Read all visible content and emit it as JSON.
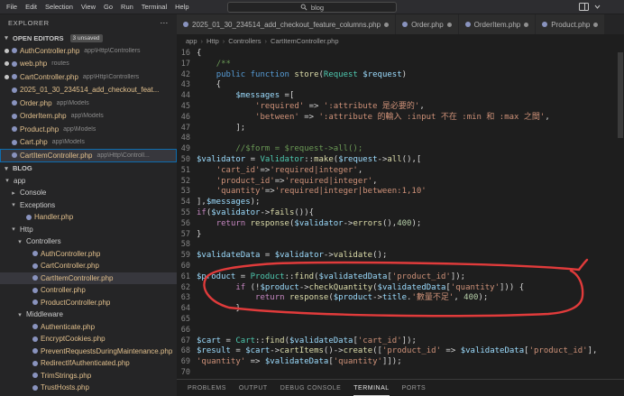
{
  "colors": {
    "titlebar_bg": "#2d2d30",
    "sidebar_bg": "#252526",
    "editor_bg": "#1e1e1e",
    "accent": "#007fd4",
    "git_modified": "#e2c08d",
    "annotation": "#e13b3b"
  },
  "titlebar": {
    "menus": [
      "File",
      "Edit",
      "Selection",
      "View",
      "Go",
      "Run",
      "Terminal",
      "Help"
    ],
    "search": {
      "value": "blog"
    }
  },
  "sidebar": {
    "title": "EXPLORER",
    "open_editors": {
      "label": "OPEN EDITORS",
      "badge": "3 unsaved",
      "items": [
        {
          "name": "AuthController.php",
          "path": "app\\Http\\Controllers",
          "dirty": true,
          "selected": false
        },
        {
          "name": "web.php",
          "path": "routes",
          "dirty": true,
          "selected": false
        },
        {
          "name": "CartController.php",
          "path": "app\\Http\\Controllers",
          "dirty": true,
          "selected": false
        },
        {
          "name": "2025_01_30_234514_add_checkout_feat...",
          "path": "",
          "dirty": false,
          "selected": false
        },
        {
          "name": "Order.php",
          "path": "app\\Models",
          "dirty": false,
          "selected": false
        },
        {
          "name": "OrderItem.php",
          "path": "app\\Models",
          "dirty": false,
          "selected": false
        },
        {
          "name": "Product.php",
          "path": "app\\Models",
          "dirty": false,
          "selected": false
        },
        {
          "name": "Cart.php",
          "path": "app\\Models",
          "dirty": false,
          "selected": false
        },
        {
          "name": "CartItemController.php",
          "path": "app\\Http\\Controll...",
          "dirty": false,
          "selected": true
        }
      ]
    },
    "workspace": {
      "label": "BLOG",
      "items": [
        {
          "label": "app",
          "indent": 0,
          "kind": "folder",
          "expanded": true,
          "selected": false
        },
        {
          "label": "Console",
          "indent": 1,
          "kind": "folder",
          "expanded": false,
          "selected": false
        },
        {
          "label": "Exceptions",
          "indent": 1,
          "kind": "folder",
          "expanded": true,
          "selected": false
        },
        {
          "label": "Handler.php",
          "indent": 2,
          "kind": "file",
          "selected": false
        },
        {
          "label": "Http",
          "indent": 1,
          "kind": "folder",
          "expanded": true,
          "selected": false
        },
        {
          "label": "Controllers",
          "indent": 2,
          "kind": "folder",
          "expanded": true,
          "selected": false
        },
        {
          "label": "AuthController.php",
          "indent": 3,
          "kind": "file",
          "selected": false
        },
        {
          "label": "CartController.php",
          "indent": 3,
          "kind": "file",
          "selected": false
        },
        {
          "label": "CartItemController.php",
          "indent": 3,
          "kind": "file",
          "selected": true
        },
        {
          "label": "Controller.php",
          "indent": 3,
          "kind": "file",
          "selected": false
        },
        {
          "label": "ProductController.php",
          "indent": 3,
          "kind": "file",
          "selected": false
        },
        {
          "label": "Middleware",
          "indent": 2,
          "kind": "folder",
          "expanded": true,
          "selected": false
        },
        {
          "label": "Authenticate.php",
          "indent": 3,
          "kind": "file",
          "selected": false
        },
        {
          "label": "EncryptCookies.php",
          "indent": 3,
          "kind": "file",
          "selected": false
        },
        {
          "label": "PreventRequestsDuringMaintenance.php",
          "indent": 3,
          "kind": "file",
          "selected": false
        },
        {
          "label": "RedirectIfAuthenticated.php",
          "indent": 3,
          "kind": "file",
          "selected": false
        },
        {
          "label": "TrimStrings.php",
          "indent": 3,
          "kind": "file",
          "selected": false
        },
        {
          "label": "TrustHosts.php",
          "indent": 3,
          "kind": "file",
          "selected": false
        }
      ]
    }
  },
  "editor": {
    "tabs": [
      {
        "label": "2025_01_30_234514_add_checkout_feature_columns.php"
      },
      {
        "label": "Order.php"
      },
      {
        "label": "OrderItem.php"
      },
      {
        "label": "Product.php"
      }
    ],
    "breadcrumb": [
      "app",
      "Http",
      "Controllers",
      "CartItemController.php"
    ],
    "code_lines": [
      {
        "n": 16,
        "t": [
          [
            "{",
            "p"
          ]
        ]
      },
      {
        "n": 17,
        "t": [
          [
            "    ",
            "p"
          ],
          [
            "/**",
            "m"
          ]
        ]
      },
      {
        "n": 42,
        "t": [
          [
            "    ",
            "p"
          ],
          [
            "public",
            "k"
          ],
          [
            " ",
            "p"
          ],
          [
            "function",
            "k"
          ],
          [
            " ",
            "p"
          ],
          [
            "store",
            "f"
          ],
          [
            "(",
            "p"
          ],
          [
            "Request",
            "t"
          ],
          [
            " ",
            "p"
          ],
          [
            "$request",
            "v"
          ],
          [
            ")",
            "p"
          ]
        ]
      },
      {
        "n": 43,
        "t": [
          [
            "    {",
            "p"
          ]
        ]
      },
      {
        "n": 44,
        "t": [
          [
            "        ",
            "p"
          ],
          [
            "$messages",
            "v"
          ],
          [
            " =[",
            "p"
          ]
        ]
      },
      {
        "n": 45,
        "t": [
          [
            "            ",
            "p"
          ],
          [
            "'required'",
            "s"
          ],
          [
            " => ",
            "p"
          ],
          [
            "':attribute 是必要的'",
            "s"
          ],
          [
            ",",
            "p"
          ]
        ]
      },
      {
        "n": 46,
        "t": [
          [
            "            ",
            "p"
          ],
          [
            "'between'",
            "s"
          ],
          [
            " => ",
            "p"
          ],
          [
            "':attribute 的輸入 :input 不在 :min 和 :max 之間'",
            "s"
          ],
          [
            ",",
            "p"
          ]
        ]
      },
      {
        "n": 47,
        "t": [
          [
            "        ];",
            "p"
          ]
        ]
      },
      {
        "n": 48,
        "t": []
      },
      {
        "n": 49,
        "t": [
          [
            "        ",
            "p"
          ],
          [
            "//$form = $request->all();",
            "m"
          ]
        ]
      },
      {
        "n": 50,
        "t": [
          [
            "$validator",
            "v"
          ],
          [
            " = ",
            "p"
          ],
          [
            "Validator",
            "t"
          ],
          [
            "::",
            "p"
          ],
          [
            "make",
            "f"
          ],
          [
            "(",
            "p"
          ],
          [
            "$request",
            "v"
          ],
          [
            "->",
            "p"
          ],
          [
            "all",
            "f"
          ],
          [
            "(),[",
            "p"
          ]
        ]
      },
      {
        "n": 51,
        "t": [
          [
            "    ",
            "p"
          ],
          [
            "'cart_id'",
            "s"
          ],
          [
            "=>",
            "p"
          ],
          [
            "'required|integer'",
            "s"
          ],
          [
            ",",
            "p"
          ]
        ]
      },
      {
        "n": 52,
        "t": [
          [
            "    ",
            "p"
          ],
          [
            "'product_id'",
            "s"
          ],
          [
            "=>",
            "p"
          ],
          [
            "'required|integer'",
            "s"
          ],
          [
            ",",
            "p"
          ]
        ]
      },
      {
        "n": 53,
        "t": [
          [
            "    ",
            "p"
          ],
          [
            "'quantity'",
            "s"
          ],
          [
            "=>",
            "p"
          ],
          [
            "'required|integer|between:1,10'",
            "s"
          ]
        ]
      },
      {
        "n": 54,
        "t": [
          [
            "],",
            "p"
          ],
          [
            "$messages",
            "v"
          ],
          [
            ");",
            "p"
          ]
        ]
      },
      {
        "n": 55,
        "t": [
          [
            "if",
            "c"
          ],
          [
            "(",
            "p"
          ],
          [
            "$validator",
            "v"
          ],
          [
            "->",
            "p"
          ],
          [
            "fails",
            "f"
          ],
          [
            "()){",
            "p"
          ]
        ]
      },
      {
        "n": 56,
        "t": [
          [
            "    ",
            "p"
          ],
          [
            "return",
            "c"
          ],
          [
            " ",
            "p"
          ],
          [
            "response",
            "f"
          ],
          [
            "(",
            "p"
          ],
          [
            "$validator",
            "v"
          ],
          [
            "->",
            "p"
          ],
          [
            "errors",
            "f"
          ],
          [
            "(),",
            "p"
          ],
          [
            "400",
            "n"
          ],
          [
            ");",
            "p"
          ]
        ]
      },
      {
        "n": 57,
        "t": [
          [
            "}",
            "p"
          ]
        ]
      },
      {
        "n": 58,
        "t": []
      },
      {
        "n": 59,
        "t": [
          [
            "$validateData",
            "v"
          ],
          [
            " = ",
            "p"
          ],
          [
            "$validator",
            "v"
          ],
          [
            "->",
            "p"
          ],
          [
            "validate",
            "f"
          ],
          [
            "();",
            "p"
          ]
        ]
      },
      {
        "n": 60,
        "t": []
      },
      {
        "n": 61,
        "t": [
          [
            "$product",
            "v"
          ],
          [
            " = ",
            "p"
          ],
          [
            "Product",
            "t"
          ],
          [
            "::",
            "p"
          ],
          [
            "find",
            "f"
          ],
          [
            "(",
            "p"
          ],
          [
            "$validatedData",
            "v"
          ],
          [
            "[",
            "p"
          ],
          [
            "'product_id'",
            "s"
          ],
          [
            "]);",
            "p"
          ]
        ]
      },
      {
        "n": 62,
        "t": [
          [
            "        ",
            "p"
          ],
          [
            "if",
            "c"
          ],
          [
            " (!",
            "p"
          ],
          [
            "$product",
            "v"
          ],
          [
            "->",
            "p"
          ],
          [
            "checkQuantity",
            "f"
          ],
          [
            "(",
            "p"
          ],
          [
            "$validatedData",
            "v"
          ],
          [
            "[",
            "p"
          ],
          [
            "'quantity'",
            "s"
          ],
          [
            "])) {",
            "p"
          ]
        ]
      },
      {
        "n": 63,
        "t": [
          [
            "            ",
            "p"
          ],
          [
            "return",
            "c"
          ],
          [
            " ",
            "p"
          ],
          [
            "response",
            "f"
          ],
          [
            "(",
            "p"
          ],
          [
            "$product",
            "v"
          ],
          [
            "->",
            "p"
          ],
          [
            "title",
            "v"
          ],
          [
            ".",
            "p"
          ],
          [
            "'數量不足'",
            "s"
          ],
          [
            ", ",
            "p"
          ],
          [
            "400",
            "n"
          ],
          [
            ");",
            "p"
          ]
        ]
      },
      {
        "n": 64,
        "t": [
          [
            "        }",
            "p"
          ]
        ]
      },
      {
        "n": 65,
        "t": []
      },
      {
        "n": 66,
        "t": []
      },
      {
        "n": 67,
        "t": [
          [
            "$cart",
            "v"
          ],
          [
            " = ",
            "p"
          ],
          [
            "Cart",
            "t"
          ],
          [
            "::",
            "p"
          ],
          [
            "find",
            "f"
          ],
          [
            "(",
            "p"
          ],
          [
            "$validateData",
            "v"
          ],
          [
            "[",
            "p"
          ],
          [
            "'cart_id'",
            "s"
          ],
          [
            "]);",
            "p"
          ]
        ]
      },
      {
        "n": 68,
        "t": [
          [
            "$result",
            "v"
          ],
          [
            " = ",
            "p"
          ],
          [
            "$cart",
            "v"
          ],
          [
            "->",
            "p"
          ],
          [
            "cartItems",
            "f"
          ],
          [
            "()->",
            "p"
          ],
          [
            "create",
            "f"
          ],
          [
            "([",
            "p"
          ],
          [
            "'product_id'",
            "s"
          ],
          [
            " => ",
            "p"
          ],
          [
            "$validateData",
            "v"
          ],
          [
            "[",
            "p"
          ],
          [
            "'product_id'",
            "s"
          ],
          [
            "],",
            "p"
          ]
        ]
      },
      {
        "n": 69,
        "t": [
          [
            "'quantity'",
            "s"
          ],
          [
            " => ",
            "p"
          ],
          [
            "$validateData",
            "v"
          ],
          [
            "[",
            "p"
          ],
          [
            "'quantity'",
            "s"
          ],
          [
            "]]);",
            "p"
          ]
        ]
      },
      {
        "n": 70,
        "t": []
      }
    ]
  },
  "panel": {
    "tabs": [
      "PROBLEMS",
      "OUTPUT",
      "DEBUG CONSOLE",
      "TERMINAL",
      "PORTS"
    ],
    "active": "TERMINAL"
  },
  "annotation": {
    "shape": "hand-drawn-box",
    "color": "#e13b3b",
    "around_lines": "61-64"
  }
}
